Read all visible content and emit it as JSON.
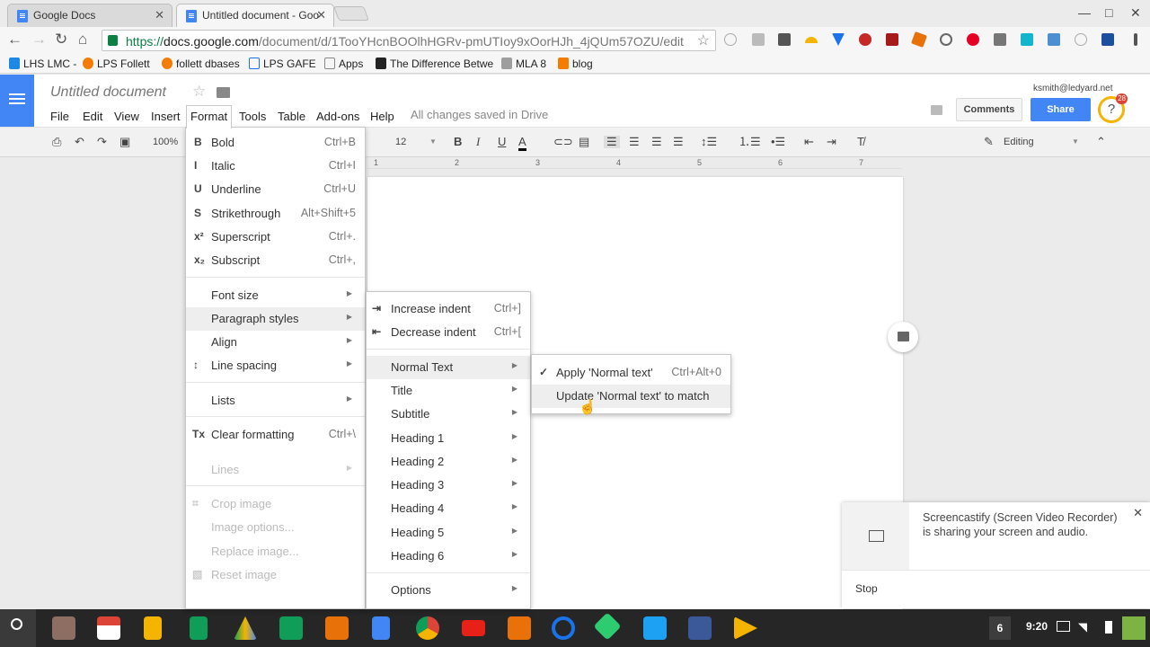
{
  "browser": {
    "tabs": [
      {
        "label": "Google Docs"
      },
      {
        "label": "Untitled document - Goo"
      }
    ],
    "url": {
      "scheme": "https://",
      "host": "docs.google.com",
      "path": "/document/d/1TooYHcnBOOlhHGRv-pmUTIoy9xOorHJh_4jQUm57OZU/edit"
    },
    "bookmarks": [
      "LHS LMC -",
      "LPS Follett",
      "follett dbases",
      "LPS GAFE",
      "Apps",
      "The Difference Betwe",
      "MLA 8",
      "blog"
    ]
  },
  "docs": {
    "title": "Untitled document",
    "menu": [
      "File",
      "Edit",
      "View",
      "Insert",
      "Format",
      "Tools",
      "Table",
      "Add-ons",
      "Help"
    ],
    "saved_status": "All changes saved in Drive",
    "user": "ksmith@ledyard.net",
    "comments_label": "Comments",
    "share_label": "Share",
    "notif_count": "28"
  },
  "toolbar": {
    "zoom": "100%",
    "font_size": "12",
    "mode": "Editing"
  },
  "ruler": [
    "1",
    "1",
    "2",
    "3",
    "4",
    "5",
    "6",
    "7"
  ],
  "format_menu": {
    "items": [
      {
        "icon": "B",
        "label": "Bold",
        "shortcut": "Ctrl+B"
      },
      {
        "icon": "I",
        "label": "Italic",
        "shortcut": "Ctrl+I"
      },
      {
        "icon": "U",
        "label": "Underline",
        "shortcut": "Ctrl+U"
      },
      {
        "icon": "S",
        "label": "Strikethrough",
        "shortcut": "Alt+Shift+5"
      },
      {
        "icon": "x²",
        "label": "Superscript",
        "shortcut": "Ctrl+."
      },
      {
        "icon": "x₂",
        "label": "Subscript",
        "shortcut": "Ctrl+,"
      },
      {
        "label": "Font size"
      },
      {
        "label": "Paragraph styles"
      },
      {
        "label": "Align"
      },
      {
        "label": "Line spacing"
      },
      {
        "label": "Lists"
      },
      {
        "label": "Clear formatting",
        "shortcut": "Ctrl+\\"
      },
      {
        "label": "Lines"
      },
      {
        "label": "Crop image"
      },
      {
        "label": "Image options..."
      },
      {
        "label": "Replace image..."
      },
      {
        "label": "Reset image"
      }
    ]
  },
  "paragraph_menu": {
    "items": [
      {
        "label": "Increase indent",
        "shortcut": "Ctrl+]"
      },
      {
        "label": "Decrease indent",
        "shortcut": "Ctrl+["
      },
      {
        "label": "Normal Text"
      },
      {
        "label": "Title"
      },
      {
        "label": "Subtitle"
      },
      {
        "label": "Heading 1"
      },
      {
        "label": "Heading 2"
      },
      {
        "label": "Heading 3"
      },
      {
        "label": "Heading 4"
      },
      {
        "label": "Heading 5"
      },
      {
        "label": "Heading 6"
      },
      {
        "label": "Options"
      }
    ]
  },
  "normal_menu": {
    "items": [
      {
        "label": "Apply 'Normal text'",
        "shortcut": "Ctrl+Alt+0"
      },
      {
        "label": "Update 'Normal text' to match"
      }
    ]
  },
  "notification": {
    "text": "Screencastify (Screen Video Recorder) is sharing your screen and audio.",
    "stop": "Stop"
  },
  "shelf": {
    "count": "6",
    "time": "9:20"
  }
}
